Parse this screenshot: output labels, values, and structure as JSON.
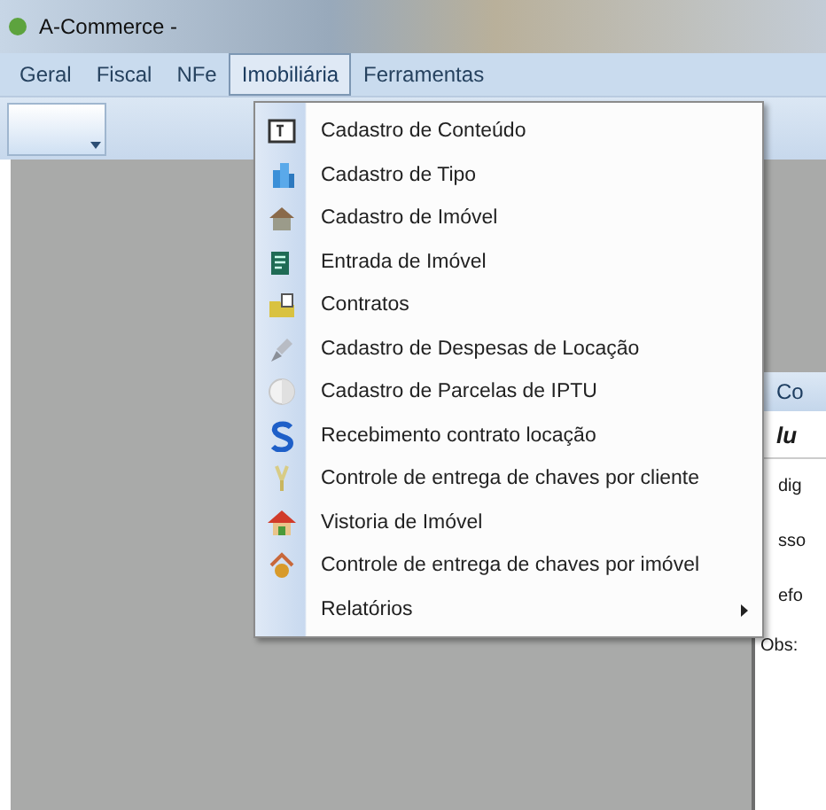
{
  "window": {
    "title": "A-Commerce -"
  },
  "menubar": [
    {
      "label": "Geral",
      "selected": false
    },
    {
      "label": "Fiscal",
      "selected": false
    },
    {
      "label": "NFe",
      "selected": false
    },
    {
      "label": "Imobiliária",
      "selected": true
    },
    {
      "label": "Ferramentas",
      "selected": false
    }
  ],
  "menu": [
    {
      "label": "Cadastro de Conteúdo",
      "submenu": false
    },
    {
      "label": "Cadastro de Tipo",
      "submenu": false
    },
    {
      "label": "Cadastro de Imóvel",
      "submenu": false
    },
    {
      "label": "Entrada de Imóvel",
      "submenu": false
    },
    {
      "label": "Contratos",
      "submenu": false
    },
    {
      "label": "Cadastro de Despesas de Locação",
      "submenu": false
    },
    {
      "label": "Cadastro de Parcelas de IPTU",
      "submenu": false
    },
    {
      "label": "Recebimento contrato locação",
      "submenu": false
    },
    {
      "label": "Controle de entrega de chaves por cliente",
      "submenu": false
    },
    {
      "label": "Vistoria de Imóvel",
      "submenu": false
    },
    {
      "label": "Controle de entrega de chaves por imóvel",
      "submenu": false
    },
    {
      "label": "Relatórios",
      "submenu": true
    }
  ],
  "child_window": {
    "title": "Co",
    "heading": "lu",
    "labels": [
      "dig",
      "sso",
      "efo",
      "Obs:"
    ]
  }
}
